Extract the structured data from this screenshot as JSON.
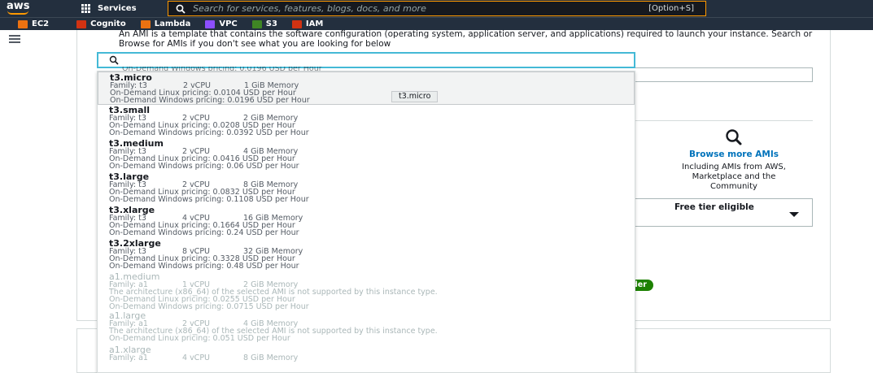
{
  "topnav": {
    "logo": "aws",
    "services_label": "Services",
    "search_placeholder": "Search for services, features, blogs, docs, and more",
    "search_shortcut": "[Option+S]"
  },
  "favorites": [
    {
      "label": "EC2",
      "color": "#ec7211"
    },
    {
      "label": "Cognito",
      "color": "#d13212"
    },
    {
      "label": "Lambda",
      "color": "#ec7211"
    },
    {
      "label": "VPC",
      "color": "#8c4fff"
    },
    {
      "label": "S3",
      "color": "#3f8624"
    },
    {
      "label": "IAM",
      "color": "#d13212"
    }
  ],
  "ami": {
    "description": "An AMI is a template that contains the software configuration (operating system, application server, and applications) required to launch your instance. Search or Browse for AMIs if you don't see what you are looking for below",
    "browse_link": "Browse more AMIs",
    "browse_sub": "Including AMIs from AWS, Marketplace and the Community",
    "free_tier": "Free tier eligible",
    "badge": "der"
  },
  "dropdown": {
    "under_text": "On-Demand Windows pricing: 0.0196 USD per Hour",
    "tooltip": "t3.micro",
    "options": [
      {
        "name": "t3.micro",
        "family": "Family: t3",
        "vcpu": "2 vCPU",
        "memory": "1 GiB Memory",
        "linux": "On-Demand Linux pricing: 0.0104 USD per Hour",
        "windows": "On-Demand Windows pricing: 0.0196 USD per Hour"
      },
      {
        "name": "t3.small",
        "family": "Family: t3",
        "vcpu": "2 vCPU",
        "memory": "2 GiB Memory",
        "linux": "On-Demand Linux pricing: 0.0208 USD per Hour",
        "windows": "On-Demand Windows pricing: 0.0392 USD per Hour"
      },
      {
        "name": "t3.medium",
        "family": "Family: t3",
        "vcpu": "2 vCPU",
        "memory": "4 GiB Memory",
        "linux": "On-Demand Linux pricing: 0.0416 USD per Hour",
        "windows": "On-Demand Windows pricing: 0.06 USD per Hour"
      },
      {
        "name": "t3.large",
        "family": "Family: t3",
        "vcpu": "2 vCPU",
        "memory": "8 GiB Memory",
        "linux": "On-Demand Linux pricing: 0.0832 USD per Hour",
        "windows": "On-Demand Windows pricing: 0.1108 USD per Hour"
      },
      {
        "name": "t3.xlarge",
        "family": "Family: t3",
        "vcpu": "4 vCPU",
        "memory": "16 GiB Memory",
        "linux": "On-Demand Linux pricing: 0.1664 USD per Hour",
        "windows": "On-Demand Windows pricing: 0.24 USD per Hour"
      },
      {
        "name": "t3.2xlarge",
        "family": "Family: t3",
        "vcpu": "8 vCPU",
        "memory": "32 GiB Memory",
        "linux": "On-Demand Linux pricing: 0.3328 USD per Hour",
        "windows": "On-Demand Windows pricing: 0.48 USD per Hour"
      }
    ],
    "disabled_options": [
      {
        "name": "a1.medium",
        "family": "Family: a1",
        "vcpu": "1 vCPU",
        "memory": "2 GiB Memory",
        "note": "The architecture (x86_64) of the selected AMI is not supported by this instance type.",
        "linux": "On-Demand Linux pricing: 0.0255 USD per Hour",
        "windows": "On-Demand Windows pricing: 0.0715 USD per Hour"
      },
      {
        "name": "a1.large",
        "family": "Family: a1",
        "vcpu": "2 vCPU",
        "memory": "4 GiB Memory",
        "note": "The architecture (x86_64) of the selected AMI is not supported by this instance type.",
        "linux": "On-Demand Linux pricing: 0.051 USD per Hour"
      },
      {
        "name": "a1.xlarge",
        "family": "Family: a1",
        "vcpu": "4 vCPU",
        "memory": "8 GiB Memory"
      }
    ]
  }
}
